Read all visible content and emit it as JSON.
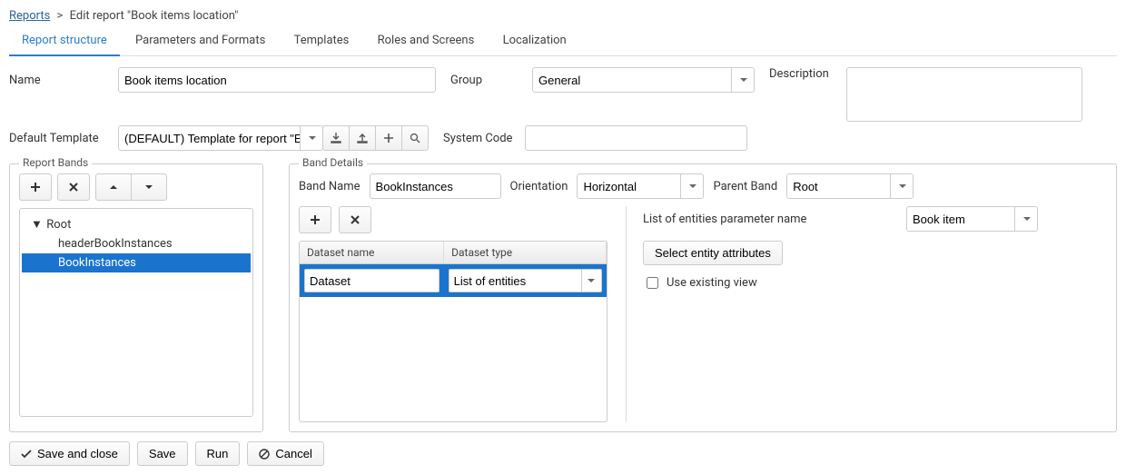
{
  "breadcrumb": {
    "root": "Reports",
    "current": "Edit report \"Book items location\""
  },
  "tabs": [
    "Report structure",
    "Parameters and Formats",
    "Templates",
    "Roles and Screens",
    "Localization"
  ],
  "form": {
    "name_label": "Name",
    "name_value": "Book items location",
    "group_label": "Group",
    "group_value": "General",
    "description_label": "Description",
    "description_value": "",
    "default_template_label": "Default Template",
    "default_template_value": "(DEFAULT) Template for report \"E",
    "system_code_label": "System Code",
    "system_code_value": ""
  },
  "bands_panel": {
    "title": "Report Bands",
    "tree": {
      "root": "Root",
      "children": [
        "headerBookInstances",
        "BookInstances"
      ],
      "selected_index": 1
    }
  },
  "details_panel": {
    "title": "Band Details",
    "band_name_label": "Band Name",
    "band_name_value": "BookInstances",
    "orientation_label": "Orientation",
    "orientation_value": "Horizontal",
    "parent_band_label": "Parent Band",
    "parent_band_value": "Root",
    "ds_columns": [
      "Dataset name",
      "Dataset type"
    ],
    "ds_row": {
      "name": "Dataset",
      "type": "List of entities"
    },
    "param_label": "List of entities parameter name",
    "param_value": "Book item",
    "select_attrs_btn": "Select entity attributes",
    "use_view_label": "Use existing view",
    "use_view_checked": false
  },
  "footer": {
    "save_close": "Save and close",
    "save": "Save",
    "run": "Run",
    "cancel": "Cancel"
  }
}
